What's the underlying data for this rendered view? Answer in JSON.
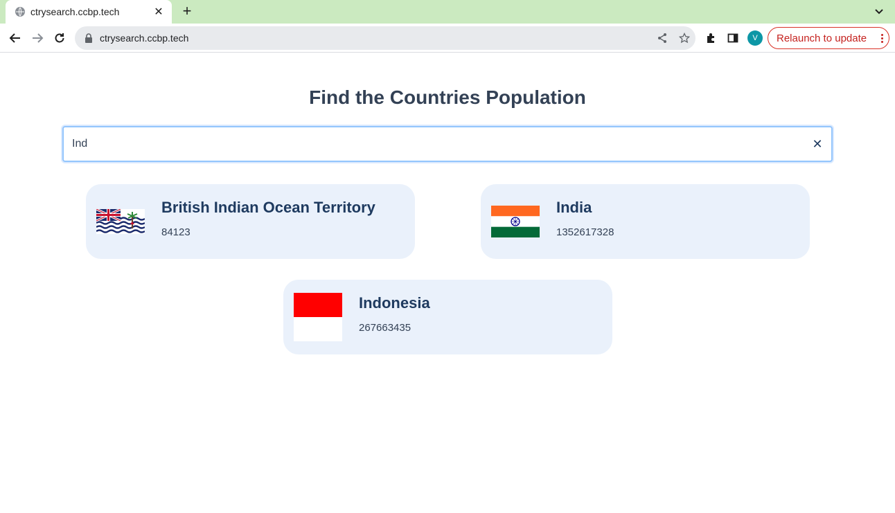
{
  "browser": {
    "tab_title": "ctrysearch.ccbp.tech",
    "url": "ctrysearch.ccbp.tech",
    "avatar_letter": "V",
    "relaunch_label": "Relaunch to update",
    "theme_color": "#cbeac0"
  },
  "page": {
    "title": "Find the Countries Population",
    "search": {
      "value": "Ind",
      "clear_icon": "✕"
    }
  },
  "countries": [
    {
      "name": "British Indian Ocean Territory",
      "population": "84123",
      "flag": "british-indian-ocean-territory-flag"
    },
    {
      "name": "India",
      "population": "1352617328",
      "flag": "india-flag"
    },
    {
      "name": "Indonesia",
      "population": "267663435",
      "flag": "indonesia-flag"
    }
  ],
  "colors": {
    "card_bg": "#eaf1fb",
    "name_text": "#1e3a5f",
    "accent_border": "#93c5fd",
    "relaunch": "#c5221f"
  }
}
